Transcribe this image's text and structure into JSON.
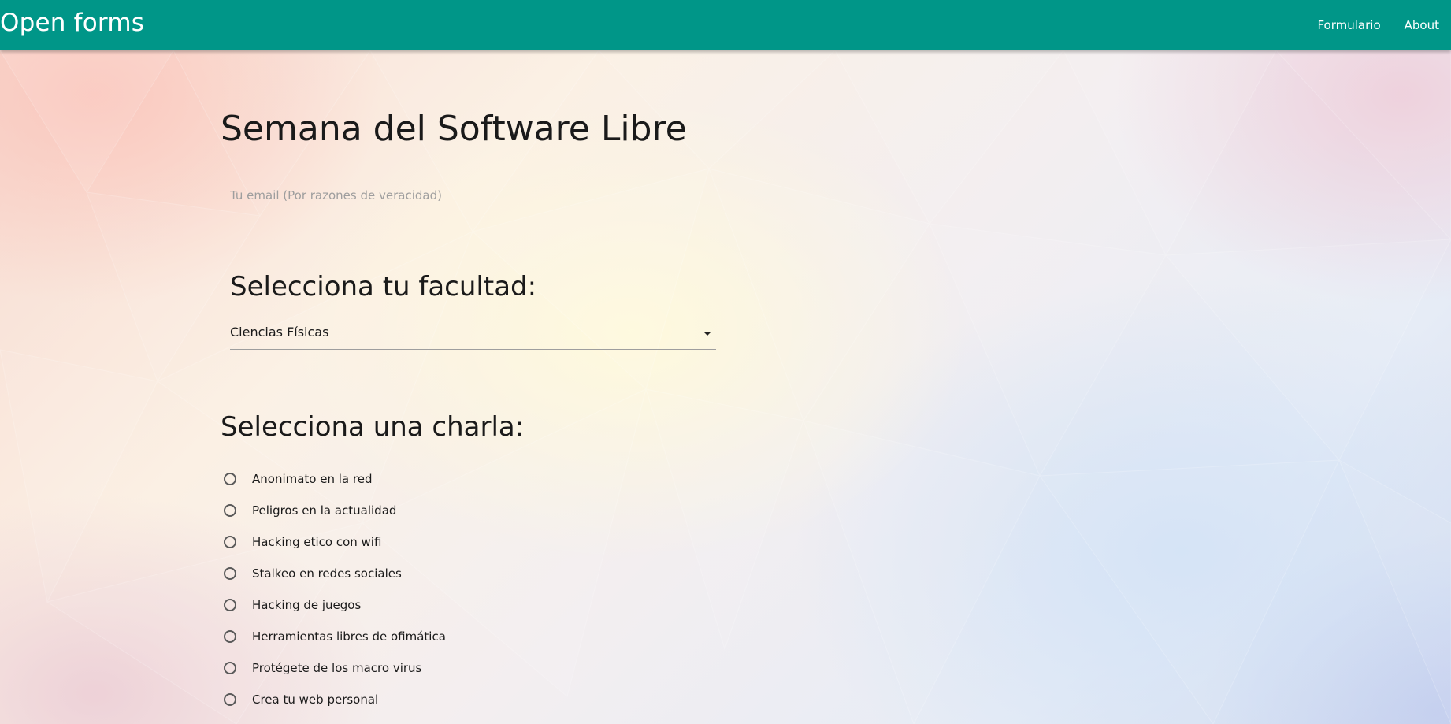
{
  "navbar": {
    "brand": "Open forms",
    "links": [
      "Formulario",
      "About"
    ]
  },
  "form": {
    "title": "Semana del Software Libre",
    "email_placeholder": "Tu email (Por razones de veracidad)",
    "faculty_heading": "Selecciona tu facultad:",
    "faculty_selected": "Ciencias Físicas",
    "talk_heading": "Selecciona una charla:",
    "talks": [
      "Anonimato en la red",
      "Peligros en la actualidad",
      "Hacking etico con wifi",
      "Stalkeo en redes sociales",
      "Hacking de juegos",
      "Herramientas libres de ofimática",
      "Protégete de los macro virus",
      "Crea tu web personal"
    ]
  },
  "colors": {
    "navbar": "#009688",
    "navbar_text": "#ffffff",
    "field_border": "#9e9e9e"
  },
  "icons": {
    "select_caret": "chevron-down-icon",
    "radio": "radio-unchecked-icon"
  }
}
